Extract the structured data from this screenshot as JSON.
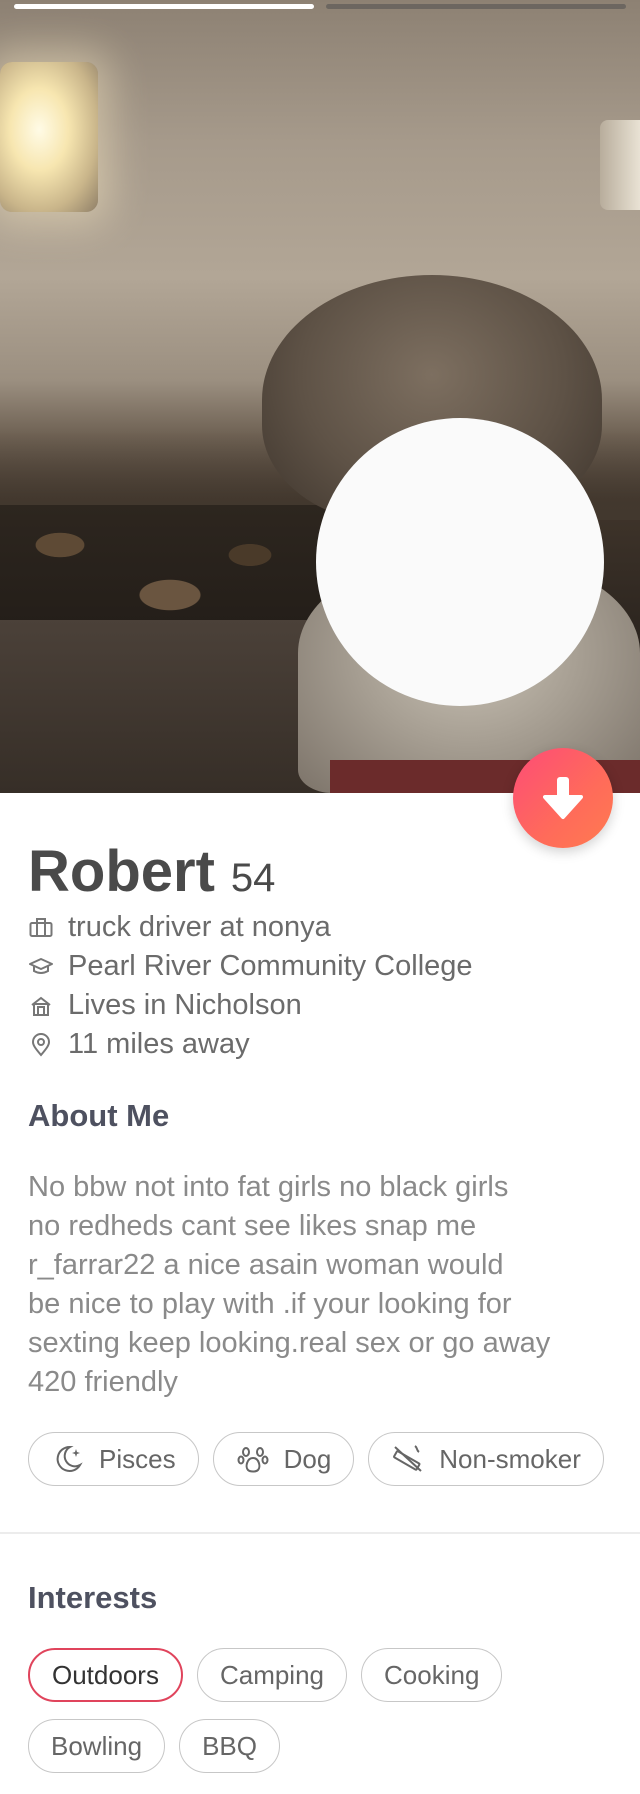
{
  "photo": {
    "progress": [
      {
        "active": true
      },
      {
        "active": false
      }
    ],
    "collapse_icon": "arrow-down-icon"
  },
  "profile": {
    "name": "Robert",
    "age": "54",
    "details": [
      {
        "icon": "briefcase-icon",
        "text": "truck driver at nonya"
      },
      {
        "icon": "graduation-cap-icon",
        "text": "Pearl River Community College"
      },
      {
        "icon": "home-icon",
        "text": "Lives in Nicholson"
      },
      {
        "icon": "location-pin-icon",
        "text": "11 miles away"
      }
    ]
  },
  "about": {
    "heading": "About Me",
    "text": "No bbw not into fat girls no black girls\nno redheds  cant see likes snap me\nr_farrar22 a nice asain woman would\nbe nice to play with .if your looking for\nsexting keep looking.real sex or go away\n420 friendly"
  },
  "lifestyle": [
    {
      "icon": "moon-icon",
      "label": "Pisces"
    },
    {
      "icon": "paw-icon",
      "label": "Dog"
    },
    {
      "icon": "no-smoking-icon",
      "label": "Non-smoker"
    }
  ],
  "interests": {
    "heading": "Interests",
    "items": [
      {
        "label": "Outdoors",
        "highlighted": true
      },
      {
        "label": "Camping",
        "highlighted": false
      },
      {
        "label": "Cooking",
        "highlighted": false
      },
      {
        "label": "Bowling",
        "highlighted": false
      },
      {
        "label": "BBQ",
        "highlighted": false
      }
    ]
  },
  "colors": {
    "accent_gradient_start": "#fd4c77",
    "accent_gradient_end": "#ff7b50",
    "highlight_border": "#e0445c",
    "heading_text": "#4e5160"
  }
}
